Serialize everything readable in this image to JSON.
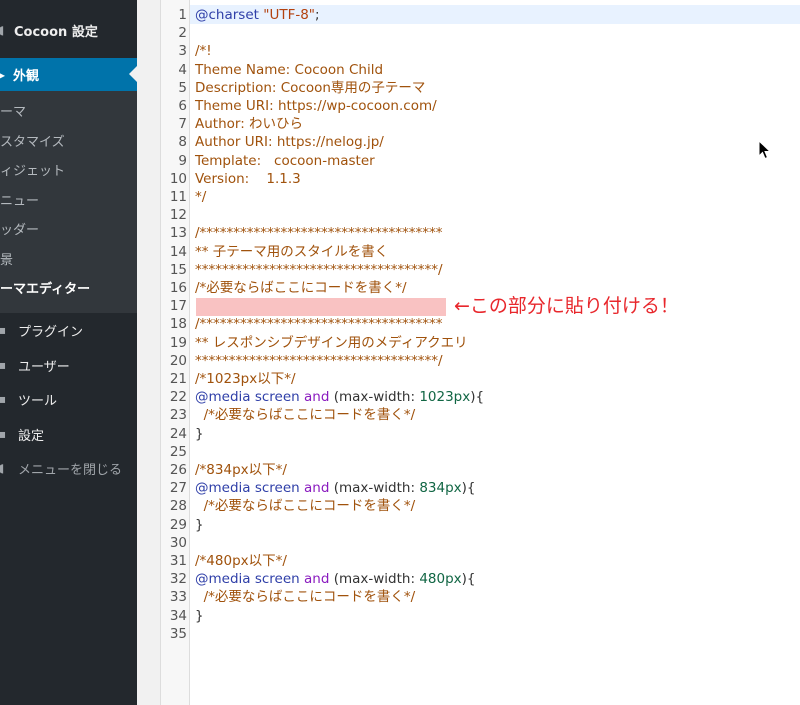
{
  "sidebar": {
    "cocoon_settings": {
      "label": "Cocoon 設定",
      "icon": "circle-icon"
    },
    "appearance": {
      "label": "外観",
      "icon": "paintbrush-icon"
    },
    "submenu": [
      {
        "label": "テーマ"
      },
      {
        "label": "カスタマイズ"
      },
      {
        "label": "ウィジェット"
      },
      {
        "label": "メニュー"
      },
      {
        "label": "ヘッダー"
      },
      {
        "label": "背景"
      },
      {
        "label": "テーマエディター",
        "current": true
      }
    ],
    "items": [
      {
        "label": "プラグイン",
        "icon": "plugin-icon"
      },
      {
        "label": "ユーザー",
        "icon": "user-icon"
      },
      {
        "label": "ツール",
        "icon": "wrench-icon"
      },
      {
        "label": "設定",
        "icon": "settings-icon"
      }
    ],
    "collapse": {
      "label": "メニューを閉じる",
      "icon": "collapse-icon"
    },
    "colors": {
      "bg": "#23282d",
      "active": "#0073aa",
      "submenu_bg": "#32373c"
    }
  },
  "editor": {
    "line_numbers": [
      "1",
      "2",
      "3",
      "4",
      "5",
      "6",
      "7",
      "8",
      "9",
      "10",
      "11",
      "12",
      "13",
      "14",
      "15",
      "16",
      "17",
      "18",
      "19",
      "20",
      "21",
      "22",
      "23",
      "24",
      "25",
      "26",
      "27",
      "28",
      "29",
      "30",
      "31",
      "32",
      "33",
      "34",
      "35"
    ],
    "lines": [
      [
        [
          "key",
          "@charset "
        ],
        [
          "str",
          "\"UTF-8\""
        ],
        [
          "plain",
          ";"
        ]
      ],
      [],
      [
        [
          "comment",
          "/*!"
        ]
      ],
      [
        [
          "comment",
          "Theme Name: Cocoon Child"
        ]
      ],
      [
        [
          "comment",
          "Description: Cocoon専用の子テーマ"
        ]
      ],
      [
        [
          "comment",
          "Theme URI: https://wp-cocoon.com/"
        ]
      ],
      [
        [
          "comment",
          "Author: わいひら"
        ]
      ],
      [
        [
          "comment",
          "Author URI: https://nelog.jp/"
        ]
      ],
      [
        [
          "comment",
          "Template:   cocoon-master"
        ]
      ],
      [
        [
          "comment",
          "Version:    1.1.3"
        ]
      ],
      [
        [
          "comment",
          "*/"
        ]
      ],
      [],
      [
        [
          "comment",
          "/************************************"
        ]
      ],
      [
        [
          "comment",
          "** 子テーマ用のスタイルを書く"
        ]
      ],
      [
        [
          "comment",
          "************************************/"
        ]
      ],
      [
        [
          "comment",
          "/*必要ならばここにコードを書く*/"
        ]
      ],
      [],
      [
        [
          "comment",
          "/************************************"
        ]
      ],
      [
        [
          "comment",
          "** レスポンシブデザイン用のメディアクエリ"
        ]
      ],
      [
        [
          "comment",
          "************************************/"
        ]
      ],
      [
        [
          "comment",
          "/*1023px以下*/"
        ]
      ],
      [
        [
          "key",
          "@media screen "
        ],
        [
          "op",
          "and"
        ],
        [
          "plain",
          " (max-width: "
        ],
        [
          "num",
          "1023px"
        ],
        [
          "plain",
          "){"
        ]
      ],
      [
        [
          "comment",
          "  /*必要ならばここにコードを書く*/"
        ]
      ],
      [
        [
          "plain",
          "}"
        ]
      ],
      [],
      [
        [
          "comment",
          "/*834px以下*/"
        ]
      ],
      [
        [
          "key",
          "@media screen "
        ],
        [
          "op",
          "and"
        ],
        [
          "plain",
          " (max-width: "
        ],
        [
          "num",
          "834px"
        ],
        [
          "plain",
          "){"
        ]
      ],
      [
        [
          "comment",
          "  /*必要ならばここにコードを書く*/"
        ]
      ],
      [
        [
          "plain",
          "}"
        ]
      ],
      [],
      [
        [
          "comment",
          "/*480px以下*/"
        ]
      ],
      [
        [
          "key",
          "@media screen "
        ],
        [
          "op",
          "and"
        ],
        [
          "plain",
          " (max-width: "
        ],
        [
          "num",
          "480px"
        ],
        [
          "plain",
          "){"
        ]
      ],
      [
        [
          "comment",
          "  /*必要ならばここにコードを書く*/"
        ]
      ],
      [
        [
          "plain",
          "}"
        ]
      ],
      []
    ],
    "highlight_line": 17,
    "highlight_color": "#f9c2c2",
    "annotation": "←この部分に貼り付ける！",
    "annotation_color": "#e8272c"
  }
}
